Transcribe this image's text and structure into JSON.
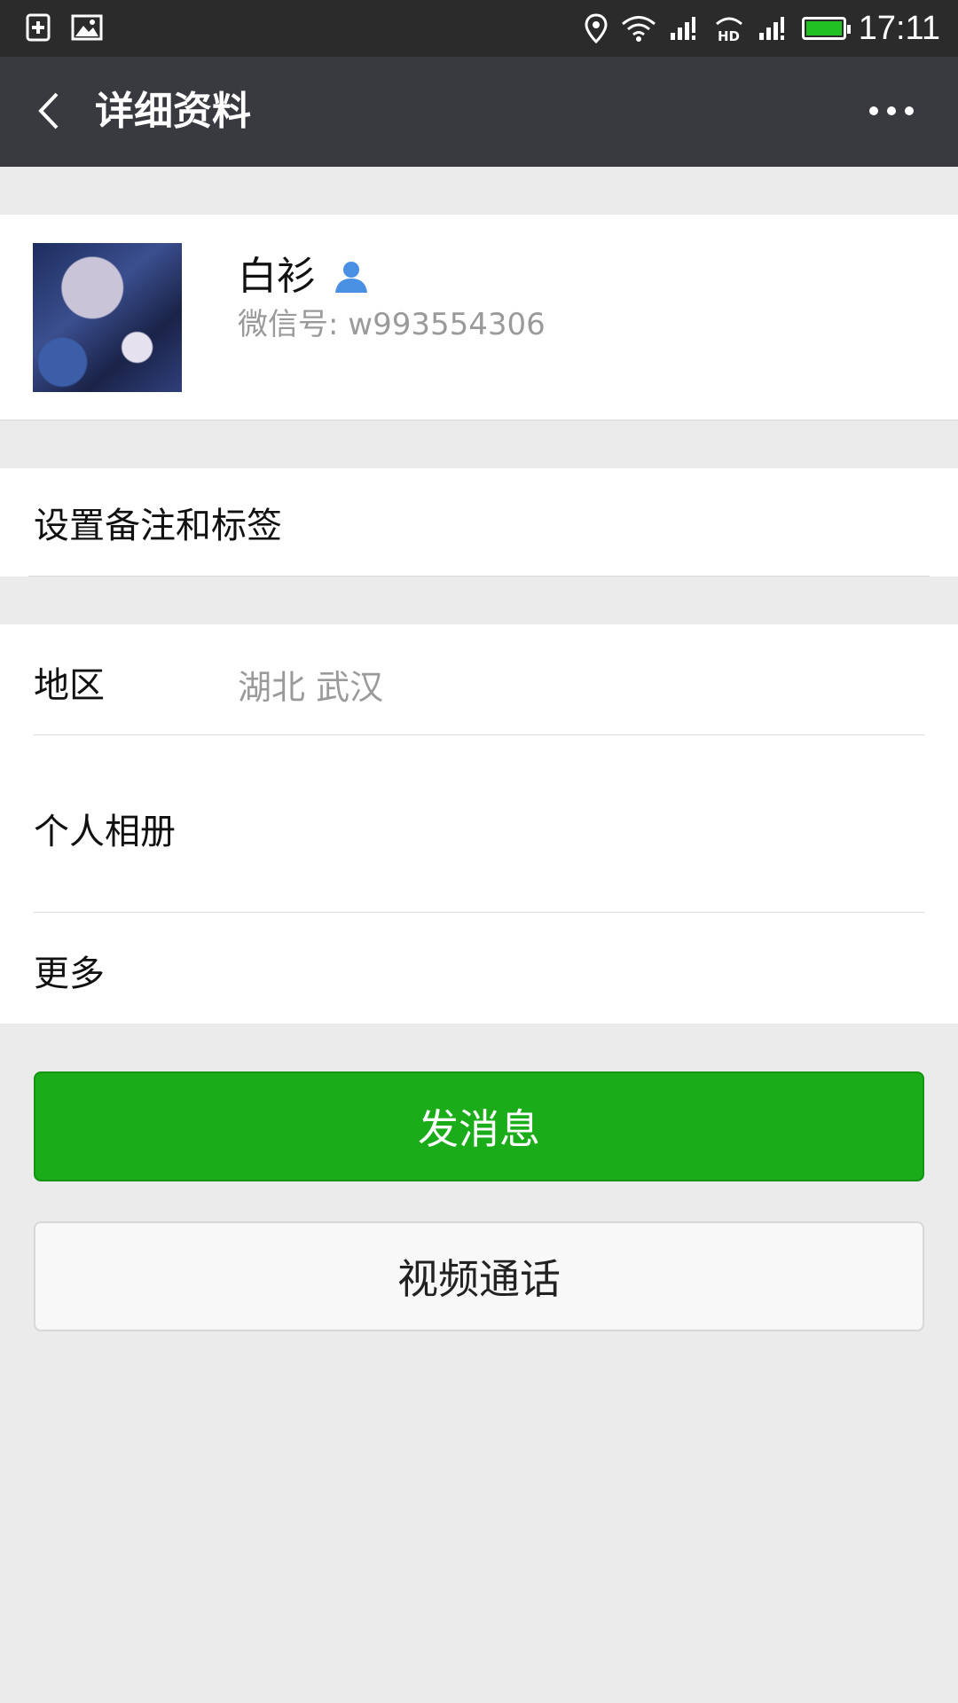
{
  "status_bar": {
    "time": "17:11",
    "icons": [
      "sim-card-icon",
      "image-icon",
      "location-icon",
      "wifi-icon",
      "signal-icon",
      "hd-call-icon",
      "signal-icon",
      "battery-icon"
    ],
    "battery_color": "#22c122"
  },
  "header": {
    "title": "详细资料",
    "back_icon": "chevron-left-icon",
    "more_icon": "more-horizontal-icon"
  },
  "profile": {
    "name": "白衫",
    "wechat_id": "微信号: w993554306",
    "badge_icon": "user-icon",
    "badge_color": "#4a90e2"
  },
  "remark": {
    "label": "设置备注和标签"
  },
  "info": {
    "region_label": "地区",
    "region_value": "湖北  武汉",
    "album_label": "个人相册",
    "more_label": "更多"
  },
  "actions": {
    "send_label": "发消息",
    "send_color": "#1aad19",
    "video_label": "视频通话"
  }
}
